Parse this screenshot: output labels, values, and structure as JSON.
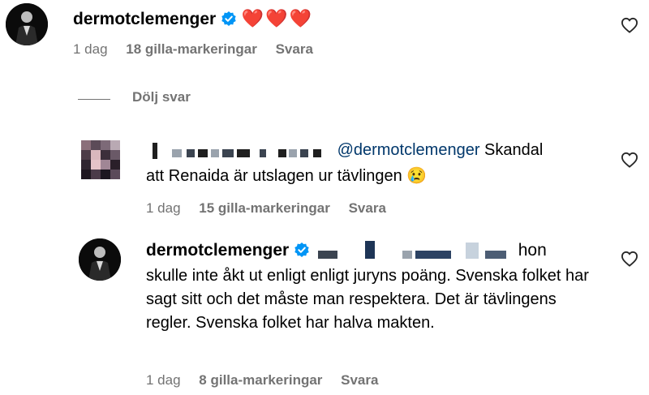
{
  "comments": [
    {
      "username": "dermotclemenger",
      "text": "❤️❤️❤️",
      "time": "1 dag",
      "likes": "18 gilla-markeringar",
      "reply_label": "Svara"
    },
    {
      "mention": "@dermotclemenger",
      "text_line1": " Skandal",
      "text_line2": "att Renaida är utslagen ur tävlingen",
      "emoji": "😢",
      "time": "1 dag",
      "likes": "15 gilla-markeringar",
      "reply_label": "Svara"
    },
    {
      "username": "dermotclemenger",
      "text_line1_tail": " hon",
      "text_rest": "skulle inte åkt ut enligt enligt juryns poäng. Svenska folket har sagt sitt och det måste man respektera. Det är tävlingens regler. Svenska folket har halva makten.",
      "time": "1 dag",
      "likes": "8 gilla-markeringar",
      "reply_label": "Svara"
    }
  ],
  "hide_replies_label": "Dölj svar",
  "colors": {
    "verified_blue": "#0095f6",
    "meta_gray": "#737373",
    "mention_blue": "#00376b",
    "heart_red": "#ed4956"
  },
  "icons": [
    "verified-icon",
    "heart-outline-icon",
    "heart-emoji",
    "crying-face-emoji"
  ]
}
